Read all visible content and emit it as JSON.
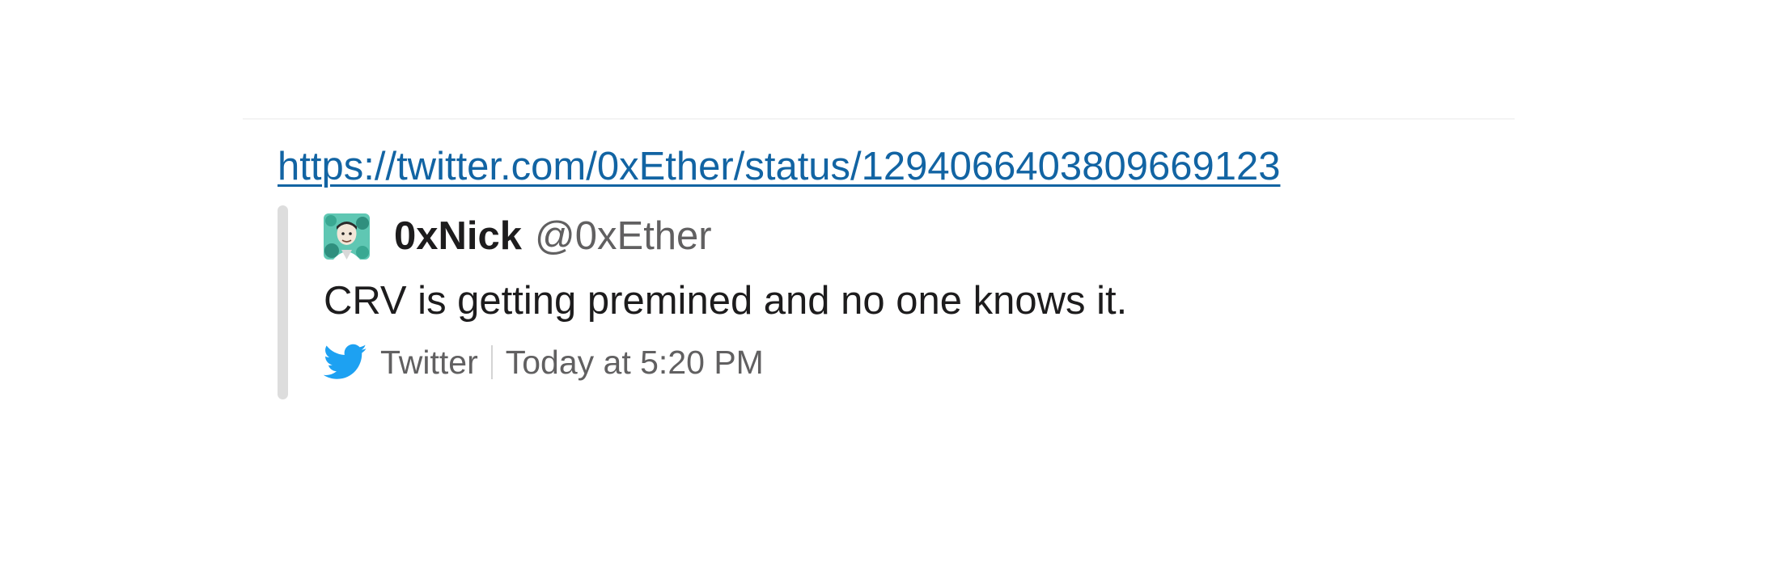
{
  "message": {
    "link_text": "https://twitter.com/0xEther/status/1294066403809669123",
    "unfurl": {
      "author_name": "0xNick",
      "author_handle": "@0xEther",
      "tweet_text": "CRV is getting premined and no one knows it.",
      "service_name": "Twitter",
      "timestamp": "Today at 5:20 PM",
      "service_icon": "twitter-bird-icon",
      "accent_color": "#1da1f2",
      "bar_color": "#dddddd",
      "link_color": "#1264a3"
    }
  }
}
